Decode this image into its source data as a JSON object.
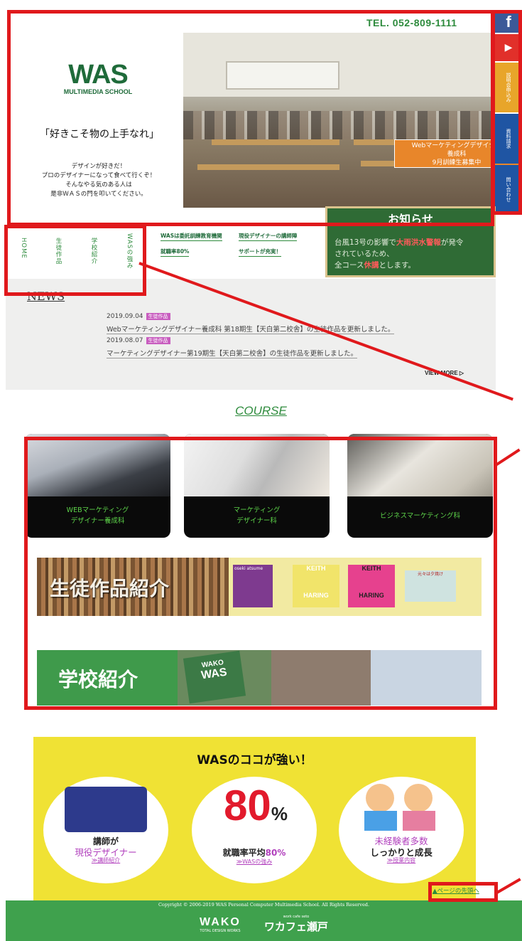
{
  "header": {
    "tel": "TEL. 052-809-1111",
    "logo_main": "WAS",
    "logo_sub": "MULTIMEDIA SCHOOL",
    "motto": "「好きこそ物の上手なれ」",
    "intro_line1": "デザインが好きだ！",
    "intro_line2": "プロのデザイナーになって食べて行くぞ！",
    "intro_line3": "そんなやる気のある人は",
    "intro_line4": "是非ＷＡＳの門を叩いてください。",
    "slider_arrow": "▶"
  },
  "hero": {
    "badge_line1": "Webマーケティングデザイナー",
    "badge_line2": "養成科",
    "badge_line3": "9月訓練生募集中"
  },
  "sns": {
    "facebook": "f",
    "youtube": "▶",
    "btn_setsumeikai": "説明会申込み",
    "btn_shiryo": "資料請求",
    "btn_toiawase": "問い合わせ",
    "colors": {
      "setsumeikai": "#e8a52a",
      "shiryo": "#1f55a3",
      "toiawase": "#1f55a3"
    }
  },
  "notice_board": {
    "title": "お知らせ",
    "line1": "台風13号の影響で",
    "line1_red": "大雨洪水警報",
    "line1_end": "が発令",
    "line2": "されているため、",
    "line3_a": "全コース",
    "line3_red": "休講",
    "line3_b": "とします。"
  },
  "nav": {
    "home": "HOME",
    "works": "生徒作品",
    "school": "学校紹介",
    "strength": "WASの強み"
  },
  "tags": {
    "t1": "WASは委託訓練教育機関",
    "t2": "現役デザイナーの講師陣",
    "t3": "就職率80%",
    "t4": "サポートが充実！"
  },
  "news": {
    "heading": "NEWS",
    "items": [
      {
        "date": "2019.09.04",
        "badge": "生徒作品",
        "text": "Webマーケティングデザイナー養成科 第18期生【天白第二校舎】の生徒作品を更新しました。"
      },
      {
        "date": "2019.08.07",
        "badge": "生徒作品",
        "text": "マーケティングデザイナー第19期生【天白第二校舎】の生徒作品を更新しました。"
      }
    ],
    "view_more": "VIEW MORE"
  },
  "course": {
    "heading": "COURSE",
    "cards": [
      {
        "line1": "WEBマーケティング",
        "line2": "デザイナー養成科"
      },
      {
        "line1": "マーケティング",
        "line2": "デザイナー科"
      },
      {
        "line1": "ビジネスマーケティング科",
        "line2": ""
      }
    ]
  },
  "banners": {
    "works": "生徒作品紹介",
    "school": "学校紹介",
    "poster1": "oseki\natsume",
    "poster2": "KEITH",
    "poster2b": "HARING",
    "poster3": "KEITH",
    "poster3b": "HARING",
    "poster4": "元々は夕焼け",
    "sign1": "WAKO",
    "sign2": "WAS"
  },
  "strengths": {
    "title": "WASのココが強い！",
    "c1_l1": "講師が",
    "c1_l2": "現役デザイナー",
    "c1_l3": "≫講師紹介",
    "c2_big": "80",
    "c2_pct": "%",
    "c2_l1": "就職率平均",
    "c2_l1b": "80%",
    "c2_l3": "≫WASの強み",
    "c3_l1": "未経験者多数",
    "c3_l2": "しっかりと成長",
    "c3_l3": "≫授業内容"
  },
  "page_top": "▲ページの先頭へ",
  "footer": {
    "copyright": "Copyright © 2006-2019 WAS Personal Computer Multimedia School. All Rights Reserved.",
    "logo1": "WAKO",
    "logo1_sub": "TOTAL DESIGN WORKS",
    "logo2": "ワカフェ瀬戸",
    "logo2_sub": "work cafe seto"
  }
}
